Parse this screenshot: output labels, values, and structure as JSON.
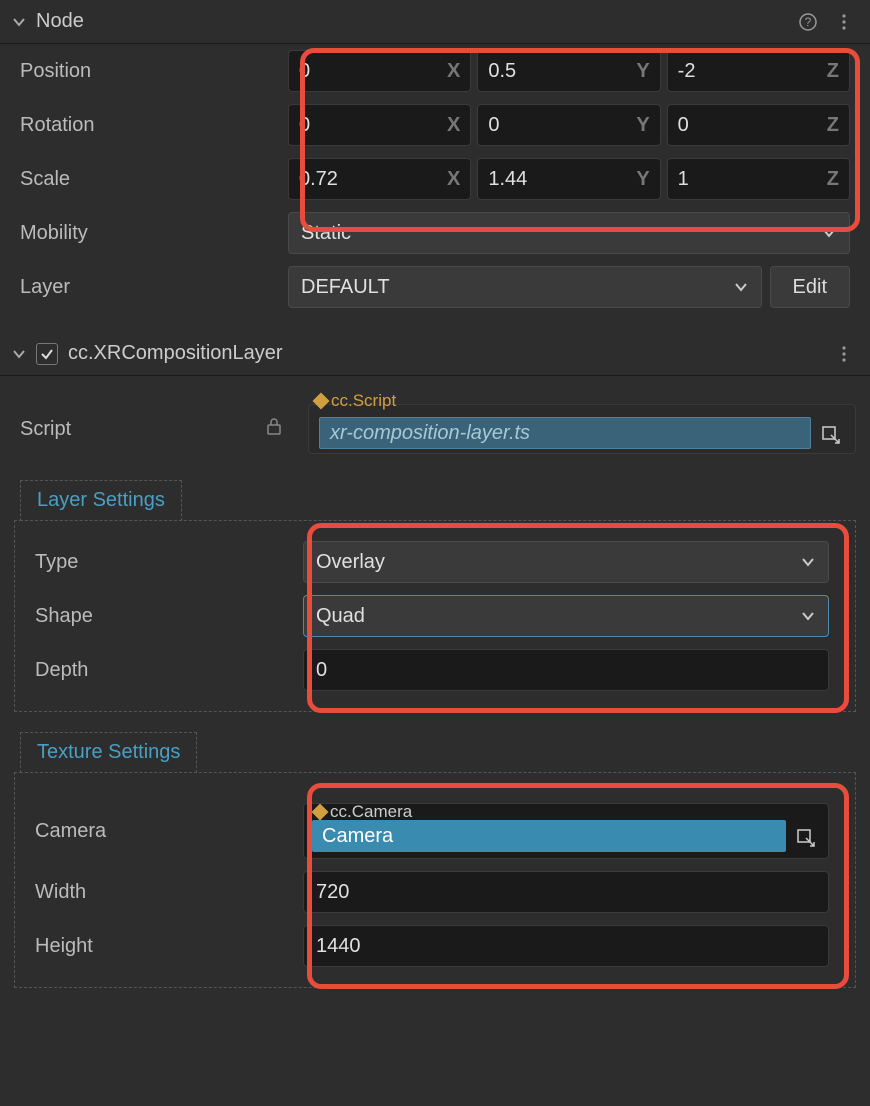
{
  "node": {
    "title": "Node",
    "position_label": "Position",
    "rotation_label": "Rotation",
    "scale_label": "Scale",
    "mobility_label": "Mobility",
    "layer_label": "Layer",
    "position": {
      "x": "0",
      "y": "0.5",
      "z": "-2"
    },
    "rotation": {
      "x": "0",
      "y": "0",
      "z": "0"
    },
    "scale": {
      "x": "0.72",
      "y": "1.44",
      "z": "1"
    },
    "axis": {
      "x": "X",
      "y": "Y",
      "z": "Z"
    },
    "mobility": "Static",
    "layer": "DEFAULT",
    "edit_label": "Edit"
  },
  "component": {
    "title": "cc.XRCompositionLayer",
    "script_label": "Script",
    "script_tag": "cc.Script",
    "script_file": "xr-composition-layer.ts",
    "layer_settings_tab": "Layer Settings",
    "type_label": "Type",
    "type_value": "Overlay",
    "shape_label": "Shape",
    "shape_value": "Quad",
    "depth_label": "Depth",
    "depth_value": "0",
    "texture_settings_tab": "Texture Settings",
    "camera_label": "Camera",
    "camera_tag": "cc.Camera",
    "camera_value": "Camera",
    "width_label": "Width",
    "width_value": "720",
    "height_label": "Height",
    "height_value": "1440"
  }
}
